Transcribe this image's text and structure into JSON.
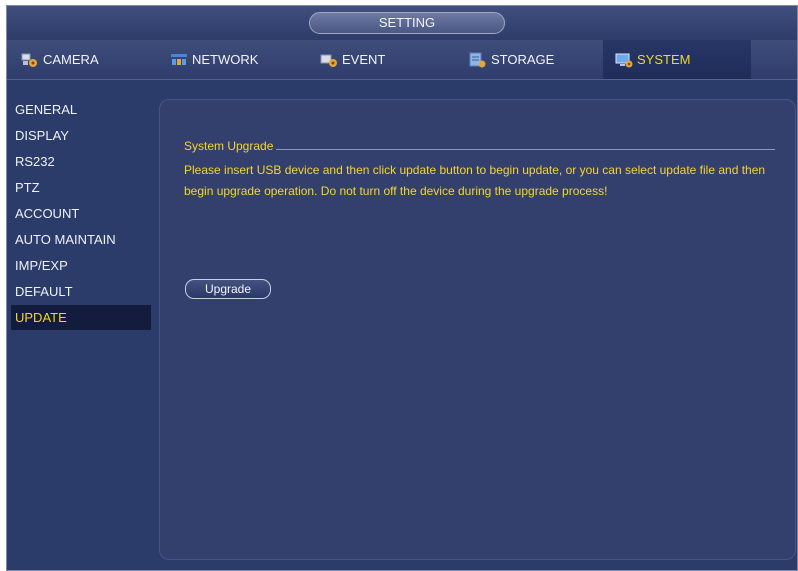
{
  "window": {
    "title": "SETTING"
  },
  "tabs": [
    {
      "label": "CAMERA",
      "icon": "camera-settings-icon",
      "active": false
    },
    {
      "label": "NETWORK",
      "icon": "network-icon",
      "active": false
    },
    {
      "label": "EVENT",
      "icon": "event-icon",
      "active": false
    },
    {
      "label": "STORAGE",
      "icon": "storage-icon",
      "active": false
    },
    {
      "label": "SYSTEM",
      "icon": "system-icon",
      "active": true
    }
  ],
  "sidebar": {
    "items": [
      {
        "label": "GENERAL",
        "active": false
      },
      {
        "label": "DISPLAY",
        "active": false
      },
      {
        "label": "RS232",
        "active": false
      },
      {
        "label": "PTZ",
        "active": false
      },
      {
        "label": "ACCOUNT",
        "active": false
      },
      {
        "label": "AUTO MAINTAIN",
        "active": false
      },
      {
        "label": "IMP/EXP",
        "active": false
      },
      {
        "label": "DEFAULT",
        "active": false
      },
      {
        "label": "UPDATE",
        "active": true
      }
    ]
  },
  "content": {
    "section_title": "System Upgrade",
    "description": "Please insert USB device and then click update button to begin update, or you can select update file and then begin upgrade operation. Do not turn off the device during the upgrade process!",
    "upgrade_button_label": "Upgrade"
  },
  "colors": {
    "background": "#2b3b6a",
    "panel": "#33406d",
    "accent_text": "#f3d62c",
    "normal_text": "#f0f2f8",
    "active_item_bg": "#131c3c"
  }
}
